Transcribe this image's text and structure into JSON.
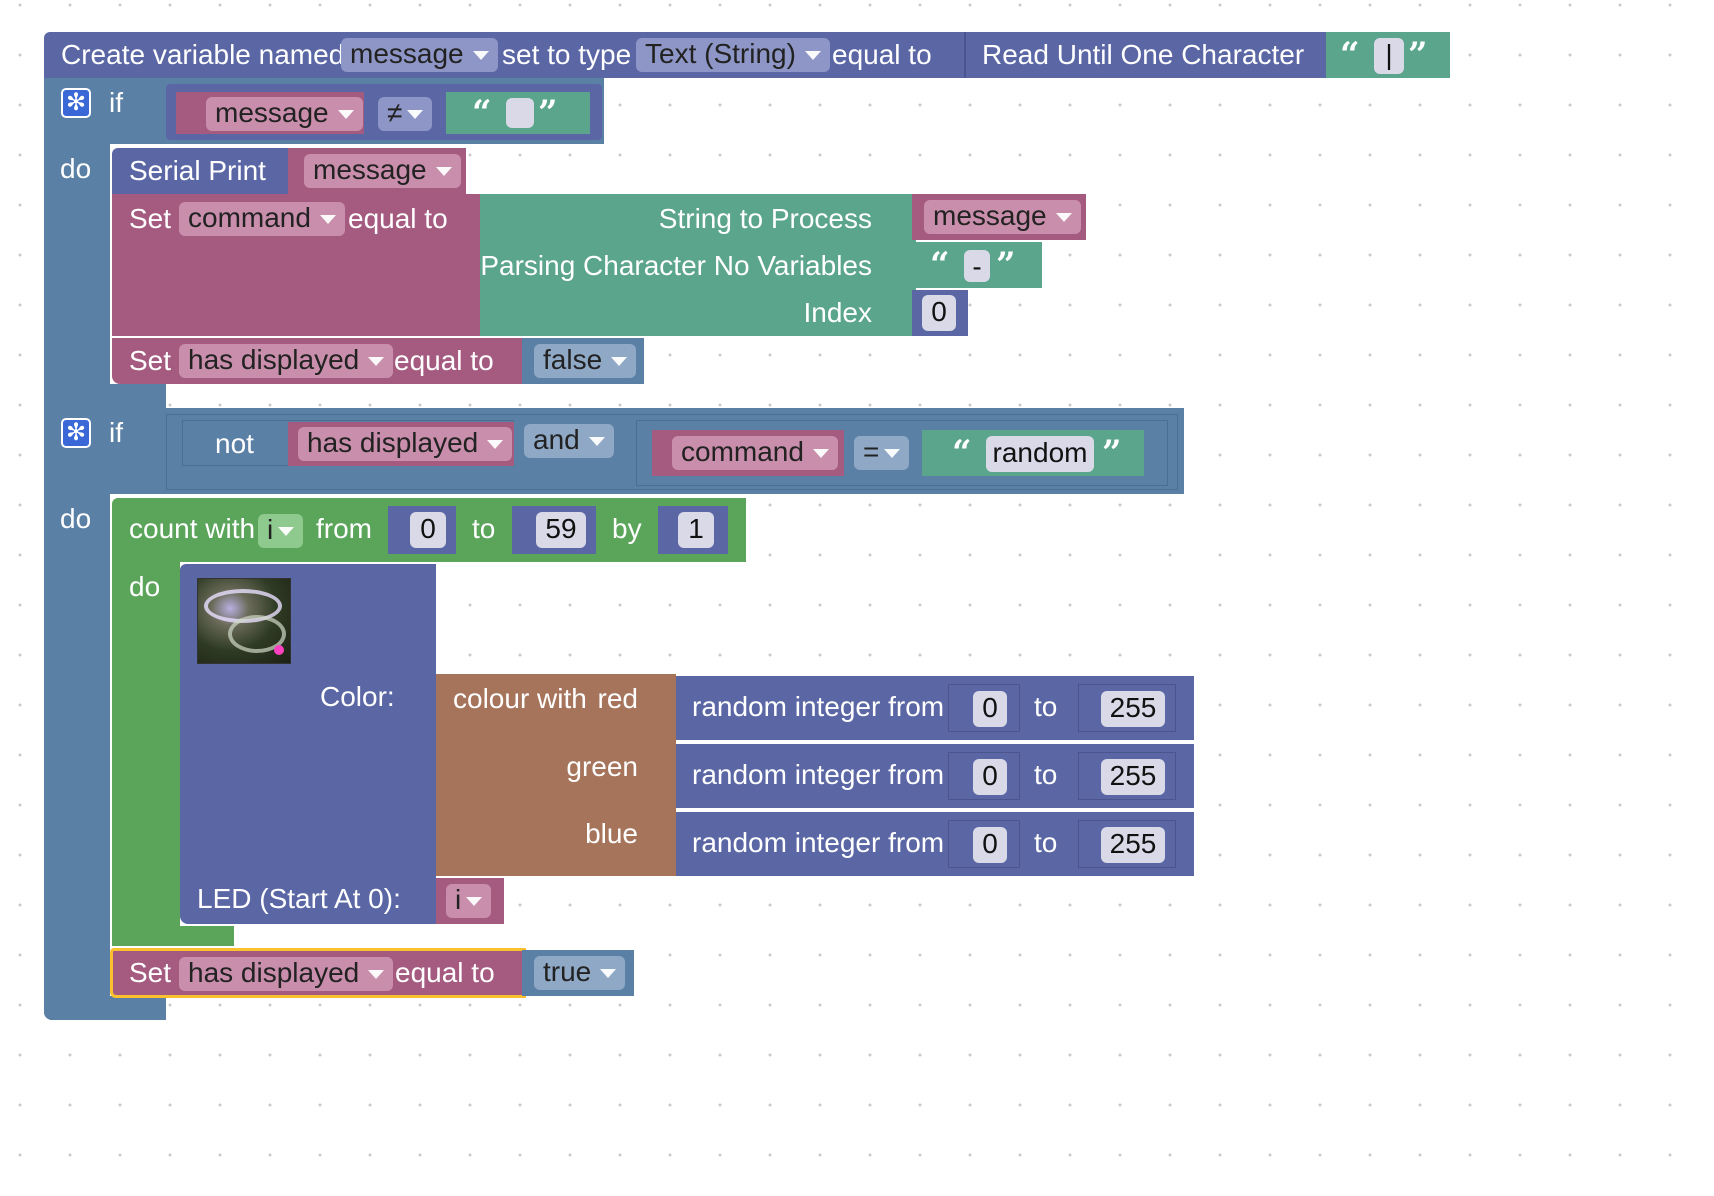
{
  "colors": {
    "control": "#5b80a5",
    "text_block": "#5ba58c",
    "variable": "#a55b80",
    "math": "#5b67a5",
    "colour": "#a5745b",
    "loop": "#5ba55b",
    "io": "#5b67a5",
    "selected_outline": "#fbc02d"
  },
  "create_var": {
    "label": "Create variable named",
    "name": "message",
    "set_to_type": "set to type",
    "type": "Text (String)",
    "equal_to": "equal to",
    "read_label": "Read Until One Character",
    "char": "|"
  },
  "if1": {
    "if_label": "if",
    "do_label": "do",
    "var": "message",
    "op": "≠",
    "text": "",
    "serial_print": "Serial Print",
    "serial_var": "message",
    "set_label": "Set",
    "command_var": "command",
    "equal_to": "equal to",
    "string_to_process": "String to Process",
    "string_var": "message",
    "parsing_label": "Parsing Character No Variables",
    "parsing_char": "-",
    "index_label": "Index",
    "index_value": "0",
    "set2_label": "Set",
    "has_displayed": "has displayed",
    "equal_to2": "equal to",
    "false_value": "false"
  },
  "if2": {
    "if_label": "if",
    "do_label": "do",
    "not_label": "not",
    "has_displayed": "has displayed",
    "and_op": "and",
    "command_var": "command",
    "eq_op": "=",
    "random_text": "random",
    "count_with": "count with",
    "loop_var": "i",
    "from": "from",
    "from_value": "0",
    "to": "to",
    "to_value": "59",
    "by": "by",
    "by_value": "1",
    "inner_do": "do",
    "color_label": "Color:",
    "colour_with": "colour with",
    "red": "red",
    "green": "green",
    "blue": "blue",
    "random_int": "random integer from",
    "rand_to": "to",
    "rand_from_value": "0",
    "rand_to_value": "255",
    "led_label": "LED (Start At 0):",
    "led_var": "i",
    "set_label": "Set",
    "has_displayed2": "has displayed",
    "equal_to": "equal to",
    "true_value": "true"
  },
  "icons": [
    "gear-icon",
    "led-strip-image",
    "dropdown-arrow-icon",
    "quote-open-icon",
    "quote-close-icon"
  ]
}
